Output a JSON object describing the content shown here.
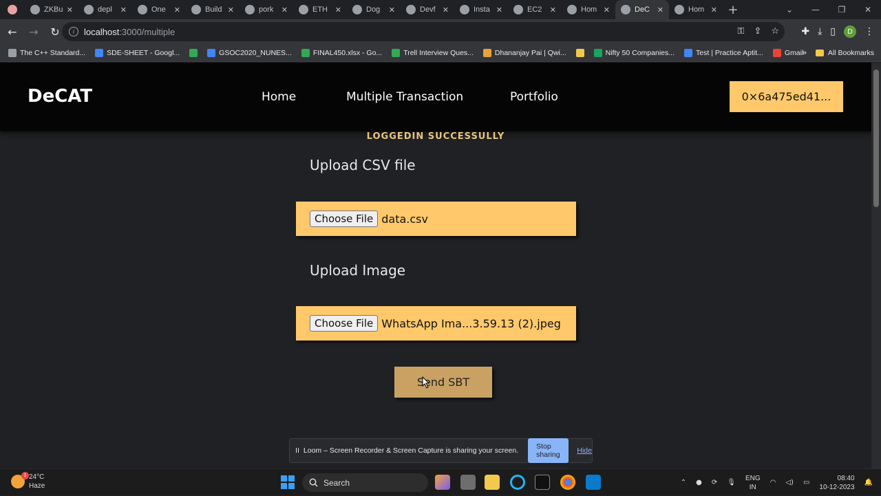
{
  "browser": {
    "tabs": [
      {
        "label": "",
        "icon": "record-icon"
      },
      {
        "label": "ZKBu",
        "icon": "github-icon"
      },
      {
        "label": "depl",
        "icon": "github-icon"
      },
      {
        "label": "One",
        "icon": "github-icon"
      },
      {
        "label": "Build",
        "icon": "page-icon"
      },
      {
        "label": "pork",
        "icon": "app-icon"
      },
      {
        "label": "ETH",
        "icon": "eth-icon"
      },
      {
        "label": "Dog",
        "icon": "github-icon"
      },
      {
        "label": "Devf",
        "icon": "devfolio-icon"
      },
      {
        "label": "Insta",
        "icon": "insta-icon"
      },
      {
        "label": "EC2",
        "icon": "aws-icon"
      },
      {
        "label": "Hom",
        "icon": "globe-icon"
      },
      {
        "label": "DeC",
        "icon": "vercel-icon",
        "active": true
      },
      {
        "label": "Hom",
        "icon": "vercel-icon"
      }
    ],
    "url_host": "localhost",
    "url_path": ":3000/multiple",
    "bookmarks": [
      {
        "label": "The C++ Standard...",
        "color": "#9aa0a6"
      },
      {
        "label": "SDE-SHEET - Googl...",
        "color": "#4285f4"
      },
      {
        "label": "",
        "color": "#34a853"
      },
      {
        "label": "GSOC2020_NUNES...",
        "color": "#4285f4"
      },
      {
        "label": "FINAL450.xlsx - Go...",
        "color": "#34a853"
      },
      {
        "label": "Trell Interview Ques...",
        "color": "#34a853"
      },
      {
        "label": "Dhananjay Pai | Qwi...",
        "color": "#e8a33a"
      },
      {
        "label": "",
        "color": "#f2c94c"
      },
      {
        "label": "Nifty 50 Companies...",
        "color": "#1aa260"
      },
      {
        "label": "Test | Practice Aptit...",
        "color": "#4285f4"
      },
      {
        "label": "Gmail",
        "color": "#ea4335"
      }
    ],
    "bookmarks_more": "»",
    "all_bookmarks": "All Bookmarks",
    "profile_initial": "D"
  },
  "app": {
    "brand": "DeCAT",
    "nav": {
      "home": "Home",
      "multiple": "Multiple Transaction",
      "portfolio": "Portfolio"
    },
    "wallet": "0×6a475ed41...",
    "login_message": "LOGGEDIN SUCCESSULLY",
    "csv_title": "Upload CSV file",
    "csv_button": "Choose File",
    "csv_file": "data.csv",
    "image_title": "Upload Image",
    "image_button": "Choose File",
    "image_file": "WhatsApp Ima...3.59.13 (2).jpeg",
    "send_button": "Send SBT"
  },
  "loom": {
    "pause": "II",
    "message": "Loom – Screen Recorder & Screen Capture is sharing your screen.",
    "stop": "Stop sharing",
    "hide": "Hide"
  },
  "taskbar": {
    "temp": "24°C",
    "weather": "Haze",
    "badge": "1",
    "search": "Search",
    "lang1": "ENG",
    "lang2": "IN",
    "time": "08:40",
    "date": "10-12-2023"
  },
  "colors": {
    "accent": "#ffc96b",
    "send": "#c9a263",
    "login": "#e9c57c"
  }
}
